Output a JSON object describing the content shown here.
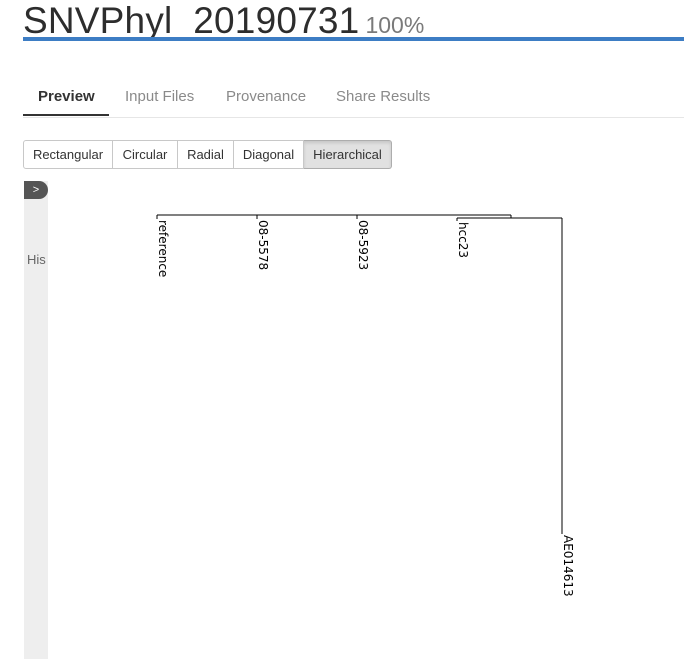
{
  "header": {
    "title": "SNVPhyl_20190731",
    "percent": "100%",
    "accent_color": "#3d7dc4"
  },
  "tabs": [
    {
      "label": "Preview",
      "active": true
    },
    {
      "label": "Input Files",
      "active": false
    },
    {
      "label": "Provenance",
      "active": false
    },
    {
      "label": "Share Results",
      "active": false
    }
  ],
  "tree_layouts": {
    "buttons": [
      "Rectangular",
      "Circular",
      "Radial",
      "Diagonal",
      "Hierarchical"
    ],
    "selected": "Hierarchical"
  },
  "sidebar": {
    "toggle_label": ">",
    "label": "His"
  },
  "tree": {
    "leaves": [
      "reference",
      "08-5578",
      "08-5923",
      "hcc23",
      "AE014613"
    ]
  }
}
